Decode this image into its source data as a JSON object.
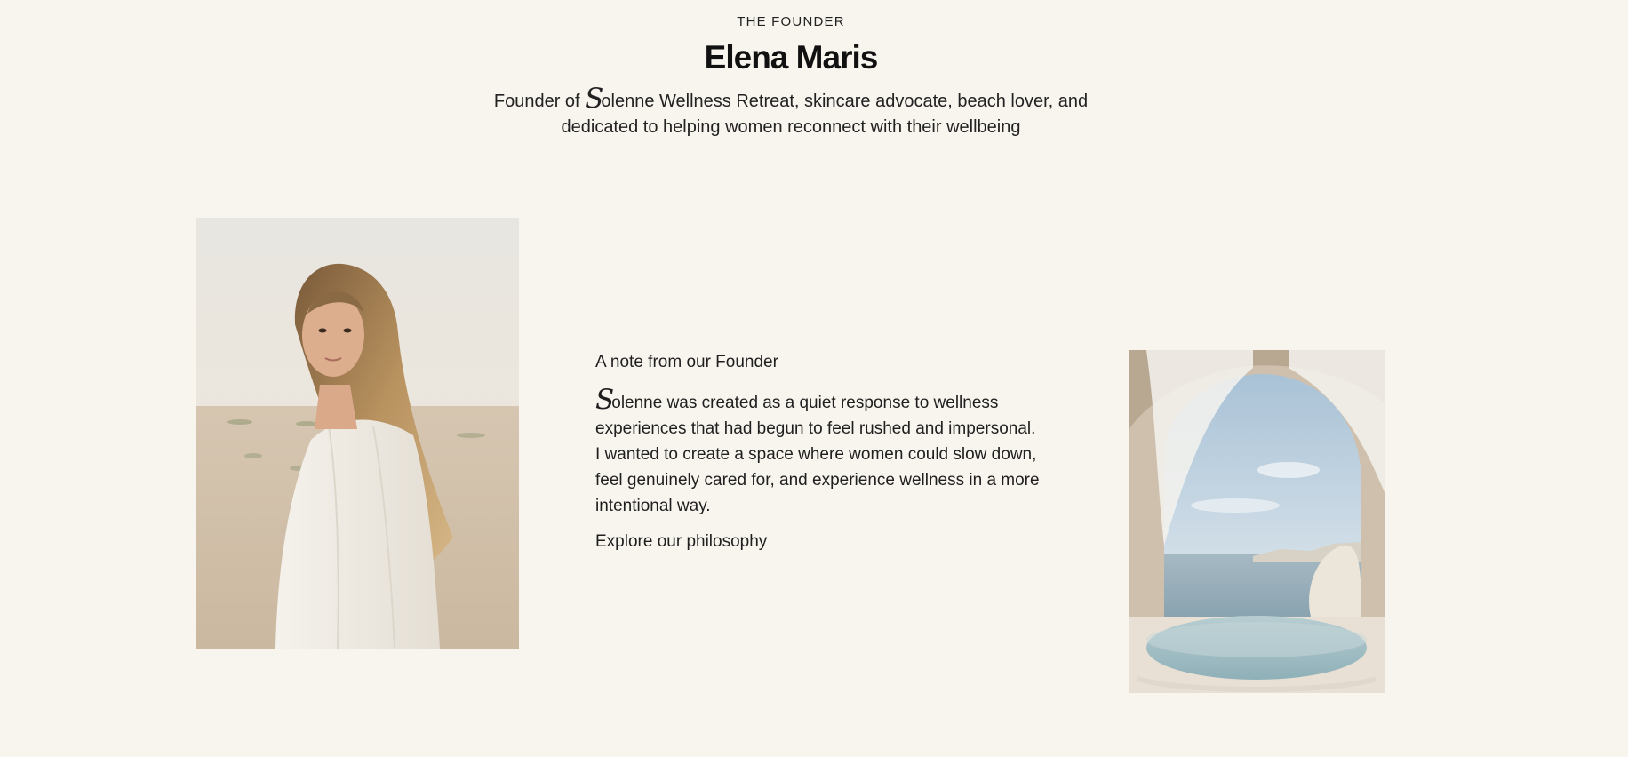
{
  "header": {
    "eyebrow": "THE FOUNDER",
    "name": "Elena Maris",
    "subline_prefix": "Founder of ",
    "brand_initial": "S",
    "subline_line1_rest": "olenne Wellness Retreat, skincare advocate, beach lover, and",
    "subline_line2": "dedicated to helping women reconnect with their wellbeing"
  },
  "note": {
    "heading": "A note from our Founder",
    "brand_initial": "S",
    "body_rest": "olenne was created as a quiet response to wellness experiences that had begun to feel rushed and impersonal. I wanted to create a space where women could slow down, feel genuinely cared for, and experience wellness in a more intentional way.",
    "link_label": "Explore our philosophy"
  },
  "colors": {
    "background": "#f8f5ee",
    "text": "#1c1c1c"
  }
}
